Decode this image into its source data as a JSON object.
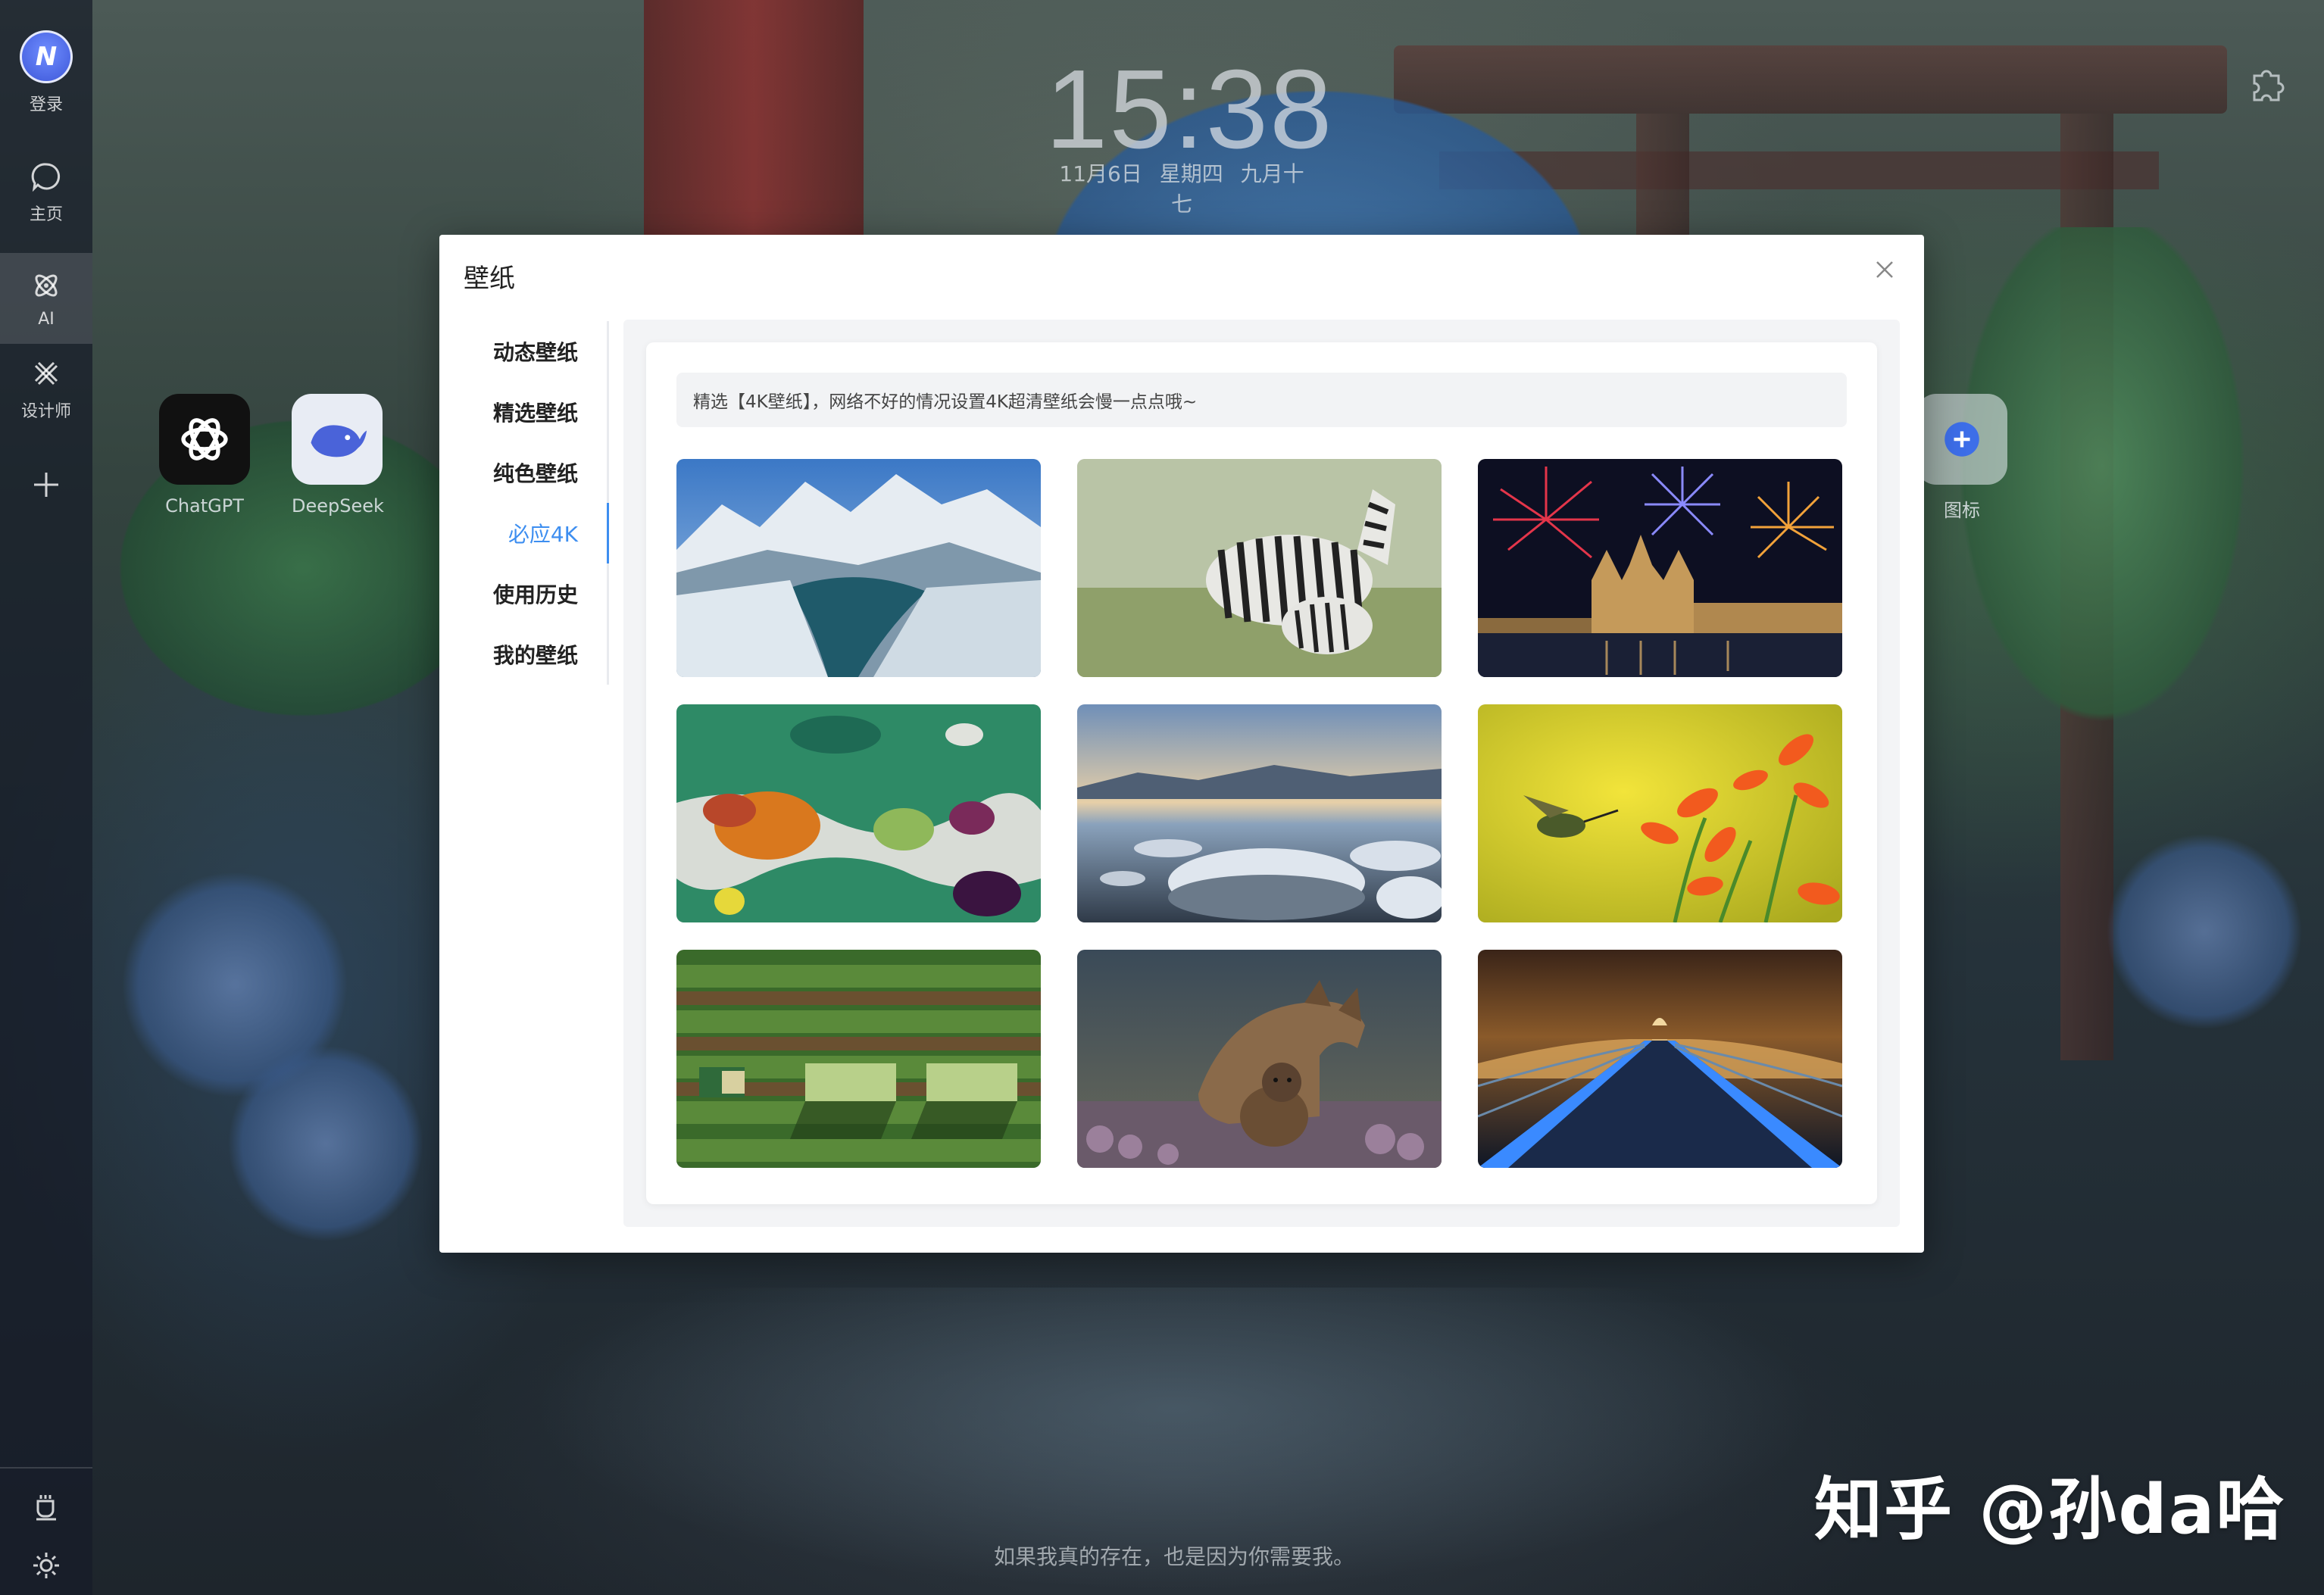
{
  "sidebar": {
    "login_label": "登录",
    "items": [
      {
        "label": "主页",
        "icon": "chat-bubble-icon"
      },
      {
        "label": "AI",
        "icon": "ai-atom-icon"
      },
      {
        "label": "设计师",
        "icon": "designer-tools-icon"
      }
    ],
    "add_icon": "plus-icon",
    "bottom_icons": [
      "coffee-icon",
      "gear-icon"
    ]
  },
  "clock": {
    "time": "15:38",
    "date": "11月6日  星期四  九月十七"
  },
  "desktop_apps": [
    {
      "label": "ChatGPT",
      "icon": "chatgpt-icon"
    },
    {
      "label": "DeepSeek",
      "icon": "deepseek-whale-icon"
    },
    {
      "label": "图标",
      "icon": "add-icon"
    }
  ],
  "modal": {
    "title": "壁纸",
    "menu": [
      {
        "label": "动态壁纸",
        "active": false
      },
      {
        "label": "精选壁纸",
        "active": false
      },
      {
        "label": "纯色壁纸",
        "active": false
      },
      {
        "label": "必应4K",
        "active": true
      },
      {
        "label": "使用历史",
        "active": false
      },
      {
        "label": "我的壁纸",
        "active": false
      }
    ],
    "notice": "精选【4K壁纸】，网络不好的情况设置4K超清壁纸会慢一点点哦~",
    "wallpapers": [
      "snowy-mountain-lake",
      "zebras-grassland",
      "fireworks-cathedral-night",
      "colorful-salt-ponds-aerial",
      "frozen-lake-ice-discs",
      "hummingbird-orange-flowers",
      "aerial-farm-tractor",
      "wolf-with-cub",
      "illuminated-bridge-night"
    ]
  },
  "quote": "如果我真的存在，也是因为你需要我。",
  "watermark": "知乎 @孙da哈",
  "colors": {
    "accent": "#3d8ef0",
    "sidebar_bg": "#161c28",
    "modal_bg": "#ffffff"
  }
}
